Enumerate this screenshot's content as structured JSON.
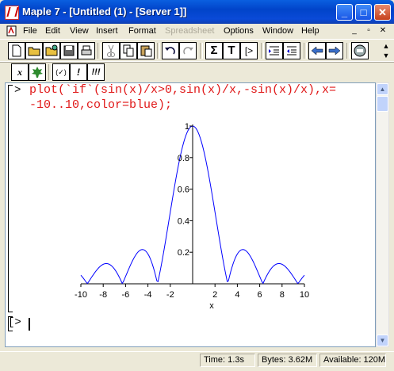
{
  "window": {
    "title": "Maple 7  - [Untitled (1) - [Server 1]]",
    "controls": [
      "_",
      "□",
      "✕"
    ]
  },
  "menu": {
    "items": [
      "File",
      "Edit",
      "View",
      "Insert",
      "Format",
      "Spreadsheet",
      "Options",
      "Window",
      "Help"
    ],
    "disabled": [
      "Spreadsheet"
    ],
    "doc_controls": [
      "_",
      "▫",
      "✕"
    ]
  },
  "toolbar": {
    "text_buttons": [
      "Σ",
      "T",
      "[>"
    ]
  },
  "context_toolbar": {
    "buttons": [
      "x",
      "(✓)",
      "!",
      "!!!"
    ]
  },
  "worksheet": {
    "prompt": ">",
    "command_line1": "plot(`if`(sin(x)/x>0,sin(x)/x,-sin(x)/x),x=",
    "command_line2": "-10..10,color=blue);",
    "empty_prompt": "[>"
  },
  "chart_data": {
    "type": "line",
    "expression": "|sin(x)/x|",
    "x_range": [
      -10,
      10
    ],
    "color": "#0000ff",
    "xlabel": "x",
    "ylabel": "",
    "x_ticks": [
      -10,
      -8,
      -6,
      -4,
      -2,
      2,
      4,
      6,
      8,
      10
    ],
    "y_ticks": [
      0.2,
      0.4,
      0.6,
      0.8,
      1
    ],
    "ylim": [
      0,
      1
    ],
    "samples": 201
  },
  "status": {
    "time": "Time:   1.3s",
    "bytes": "Bytes: 3.62M",
    "available": "Available: 120M"
  }
}
